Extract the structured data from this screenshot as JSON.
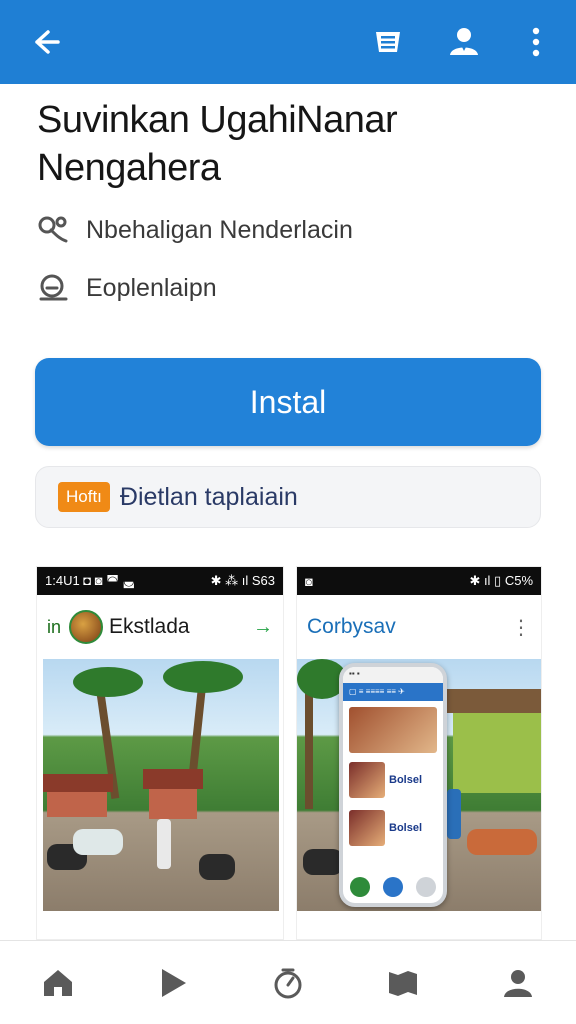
{
  "app_bar": {
    "background": "#1f7fd4",
    "icons": [
      "back-arrow-icon",
      "list-icon",
      "account-icon",
      "more-vert-icon"
    ]
  },
  "app": {
    "title": "Suvinkan UgahiNanar Nengahera",
    "developer": "Nbehaligan Nenderlacin",
    "category": "Eoplenlaipn"
  },
  "install_button": {
    "label": "Instal",
    "color": "#2282d8"
  },
  "promo": {
    "badge": "Hoftı",
    "text": "Đietlan taplaiain",
    "badge_color": "#f08a16"
  },
  "screenshots": [
    {
      "status_left": "1:4U1 ◘ ◙ ◚ ◛",
      "status_right": "✱ ⁂ ıl S63",
      "header_prefix": "in",
      "header_title": "Ekstlada",
      "header_arrow": "→"
    },
    {
      "status_left": "◙",
      "status_right": "✱ ıl ▯ C5%",
      "header_title": "Corbysav",
      "header_dots": "⋮",
      "phone_header": "▢ ≡ ≡≡≡≡ ≡≡ ✈",
      "card1": "Bolsel",
      "card2": "Bolsel"
    }
  ],
  "bottom_nav": [
    "home-icon",
    "play-icon",
    "timer-icon",
    "map-icon",
    "profile-icon"
  ]
}
